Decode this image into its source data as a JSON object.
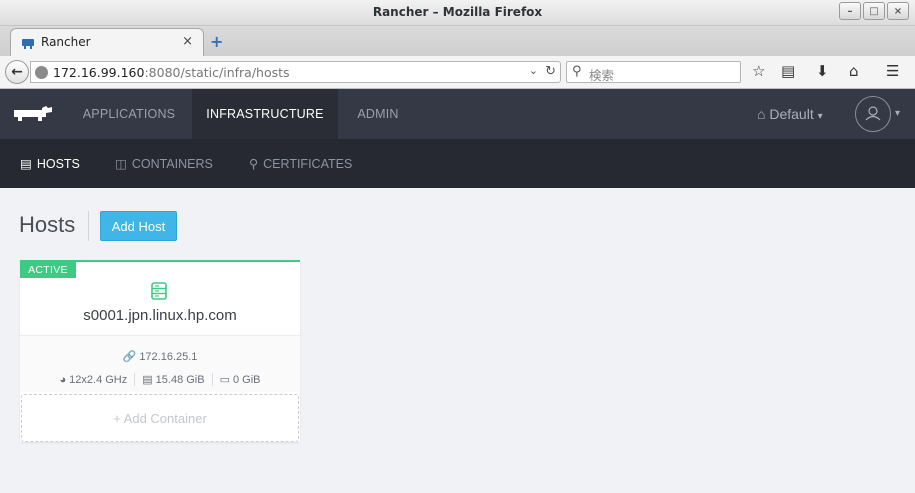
{
  "window": {
    "title": "Rancher – Mozilla Firefox",
    "controls": [
      "–",
      "□",
      "×"
    ]
  },
  "browser": {
    "tab_title": "Rancher",
    "tab_close": "×",
    "new_tab": "+",
    "url_host": "172.16.99.160",
    "url_rest": ":8080/static/infra/hosts",
    "search_placeholder": "検索"
  },
  "header": {
    "nav": [
      {
        "label": "APPLICATIONS"
      },
      {
        "label": "INFRASTRUCTURE",
        "active": true
      },
      {
        "label": "ADMIN"
      }
    ],
    "environment": "Default"
  },
  "subnav": [
    {
      "label": "HOSTS",
      "active": true,
      "icon": "hosts-icon"
    },
    {
      "label": "CONTAINERS",
      "icon": "container-icon"
    },
    {
      "label": "CERTIFICATES",
      "icon": "key-icon"
    }
  ],
  "page": {
    "title": "Hosts",
    "add_button": "Add Host"
  },
  "host": {
    "state": "ACTIVE",
    "name": "s0001.jpn.linux.hp.com",
    "ip": "172.16.25.1",
    "cpu": "12x2.4 GHz",
    "memory": "15.48 GiB",
    "storage": "0 GiB",
    "add_container": "+ Add Container"
  },
  "colors": {
    "header_bg": "#353845",
    "subheader_bg": "#272932",
    "active_green": "#3dcb84",
    "primary_blue": "#3fb6e7"
  }
}
